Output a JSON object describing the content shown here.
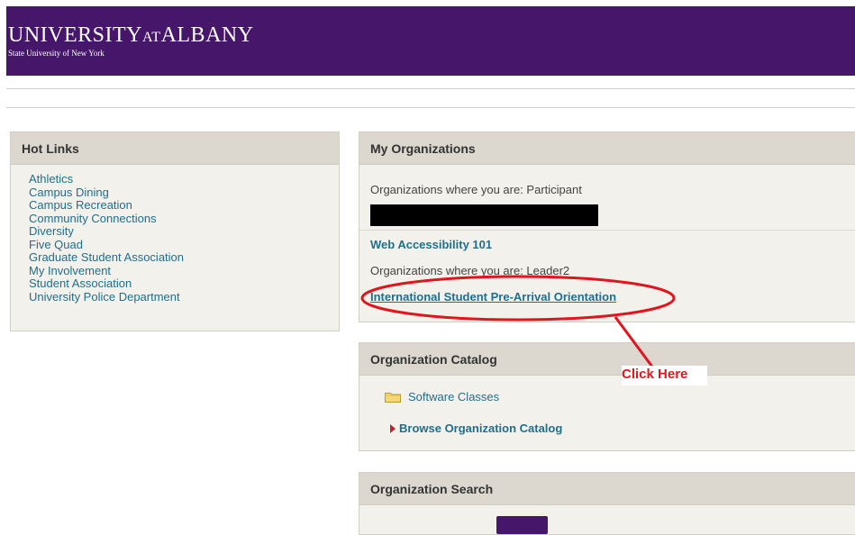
{
  "header": {
    "logo_word1": "UNIVERSITY",
    "logo_word2": "AT",
    "logo_word3": "ALBANY",
    "logo_sub": "State University of New York",
    "bg_color": "#46166b"
  },
  "hot_links": {
    "title": "Hot Links",
    "items": [
      "Athletics",
      "Campus Dining",
      "Campus Recreation",
      "Community Connections",
      "Diversity",
      "Five Quad",
      "Graduate Student Association",
      "My Involvement",
      "Student Association",
      "University Police Department"
    ]
  },
  "my_organizations": {
    "title": "My Organizations",
    "participant_label": "Organizations where you are: Participant",
    "participant_org": "Web Accessibility 101",
    "leader_label": "Organizations where you are: Leader2",
    "leader_org": "International Student Pre-Arrival Orientation"
  },
  "organization_catalog": {
    "title": "Organization Catalog",
    "folder": "Software Classes",
    "browse_link": "Browse Organization Catalog"
  },
  "organization_search": {
    "title": "Organization Search"
  },
  "annotation": {
    "text": "Click Here",
    "color": "#e0161e"
  },
  "icons": {
    "folder": "folder-icon",
    "bullet": "red-triangle-icon"
  }
}
